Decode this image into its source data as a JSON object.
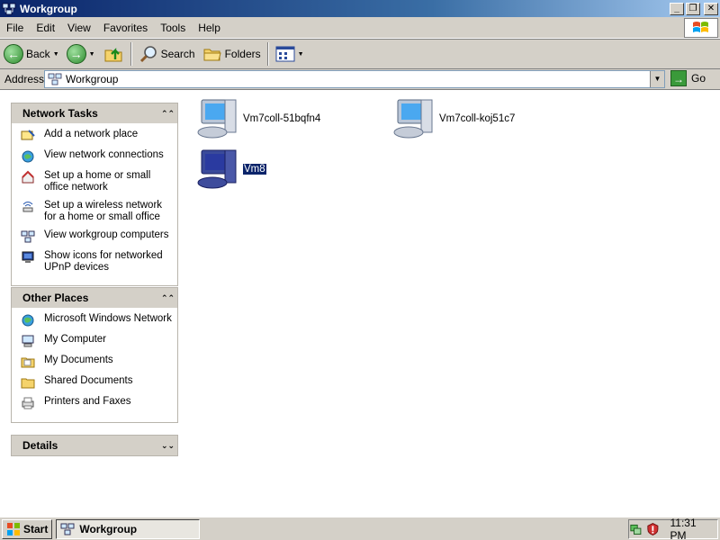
{
  "window": {
    "title": "Workgroup",
    "controls": {
      "minimize": "_",
      "maximize": "❐",
      "close": "✕"
    }
  },
  "menu": {
    "items": [
      "File",
      "Edit",
      "View",
      "Favorites",
      "Tools",
      "Help"
    ]
  },
  "toolbar": {
    "back_label": "Back",
    "search_label": "Search",
    "folders_label": "Folders"
  },
  "address": {
    "label": "Address",
    "value": "Workgroup",
    "go_label": "Go"
  },
  "tasks": {
    "network": {
      "title": "Network Tasks",
      "items": [
        {
          "label": "Add a network place",
          "icon": "add-network-place-icon"
        },
        {
          "label": "View network connections",
          "icon": "network-connections-icon"
        },
        {
          "label": "Set up a home or small office network",
          "icon": "home-network-icon"
        },
        {
          "label": "Set up a wireless network for a home or small office",
          "icon": "wireless-network-icon"
        },
        {
          "label": "View workgroup computers",
          "icon": "workgroup-computers-icon"
        },
        {
          "label": "Show icons for networked UPnP devices",
          "icon": "upnp-devices-icon"
        }
      ]
    },
    "other": {
      "title": "Other Places",
      "items": [
        {
          "label": "Microsoft Windows Network",
          "icon": "windows-network-icon"
        },
        {
          "label": "My Computer",
          "icon": "my-computer-icon"
        },
        {
          "label": "My Documents",
          "icon": "my-documents-icon"
        },
        {
          "label": "Shared Documents",
          "icon": "shared-documents-icon"
        },
        {
          "label": "Printers and Faxes",
          "icon": "printer-icon"
        }
      ]
    },
    "details": {
      "title": "Details"
    }
  },
  "computers": [
    {
      "name": "Vm7coll-51bqfn4",
      "selected": false
    },
    {
      "name": "Vm7coll-koj51c7",
      "selected": false
    },
    {
      "name": "Vm8",
      "selected": true
    }
  ],
  "taskbar": {
    "start_label": "Start",
    "task_label": "Workgroup",
    "clock": "11:31 PM"
  },
  "colors": {
    "titlebar": "#0a246a",
    "selection": "#0a246a",
    "chrome": "#d4d0c8"
  }
}
